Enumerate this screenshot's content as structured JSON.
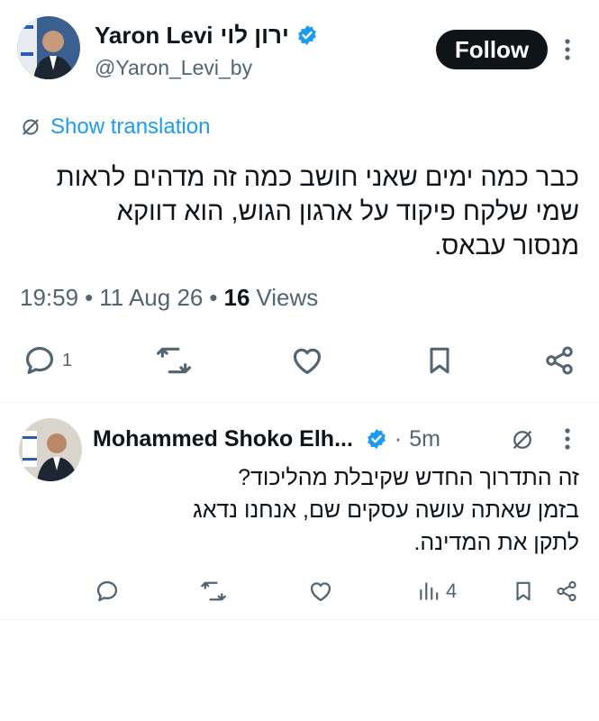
{
  "tweet": {
    "author_name": "Yaron Levi",
    "author_name_hebrew": "ירון לוי",
    "handle": "@Yaron_Levi_by",
    "follow_label": "Follow",
    "translation_label": "Show translation",
    "text_lines": [
      "כבר כמה ימים שאני חושב כמה זה מדהים לראות",
      "שמי שלקח פיקוד על ארגון הגוש, הוא דווקא",
      "מנסור עבאס."
    ],
    "time": "19:59",
    "date": "11 Aug 26",
    "views_count": "16",
    "views_label": "Views",
    "separator": "•",
    "reply_count": "1"
  },
  "reply": {
    "author_name": "Mohammed Shoko Elh...",
    "time_ago": "5m",
    "separator": "·",
    "text_lines": [
      "זה התדרוך החדש שקיבלת מהליכוד?",
      "בזמן שאתה עושה עסקים שם, אנחנו נדאג",
      "לתקן את המדינה."
    ],
    "views_count": "4"
  },
  "colors": {
    "text": "#0f1419",
    "muted": "#536471",
    "accent": "#1d9bf0",
    "verified": "#1d9bf0",
    "follow_bg": "#0f1419"
  },
  "icons": [
    "verified-badge-icon",
    "more-options-icon",
    "translate-icon",
    "reply-icon",
    "retweet-icon",
    "like-icon",
    "bookmark-icon",
    "share-icon",
    "views-icon"
  ]
}
